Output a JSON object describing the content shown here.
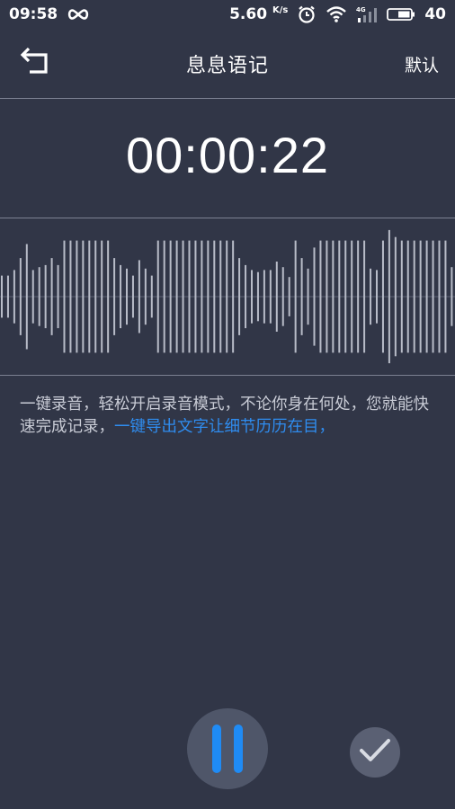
{
  "status_bar": {
    "time": "09:58",
    "speed": "5.60",
    "speed_unit": "K/s",
    "network_label": "4G",
    "battery": "40",
    "icons": [
      "infinity-icon",
      "alarm-icon",
      "wifi-icon",
      "signal-icon",
      "battery-icon"
    ]
  },
  "header": {
    "title": "息息语记",
    "default_label": "默认",
    "back_icon": "back-arrow-icon"
  },
  "timer": "00:00:22",
  "waveform": {
    "color": "#b8bcc8",
    "levels": [
      0.3,
      0.3,
      0.38,
      0.55,
      0.75,
      0.38,
      0.42,
      0.45,
      0.55,
      0.45,
      0.8,
      0.8,
      0.8,
      0.8,
      0.8,
      0.8,
      0.8,
      0.8,
      0.55,
      0.45,
      0.4,
      0.3,
      0.52,
      0.4,
      0.3,
      0.8,
      0.8,
      0.8,
      0.8,
      0.8,
      0.8,
      0.8,
      0.8,
      0.8,
      0.8,
      0.8,
      0.8,
      0.8,
      0.55,
      0.45,
      0.38,
      0.35,
      0.38,
      0.38,
      0.5,
      0.42,
      0.28,
      0.8,
      0.55,
      0.4,
      0.7,
      0.8,
      0.8,
      0.8,
      0.8,
      0.8,
      0.8,
      0.8,
      0.8,
      0.4,
      0.38,
      0.8,
      0.95,
      0.85,
      0.8,
      0.8,
      0.8,
      0.8,
      0.8,
      0.8,
      0.8,
      0.8,
      0.42,
      0.38,
      0.45,
      0.52,
      0.45,
      0.55,
      0.55,
      0.4,
      0.4,
      0.6,
      0.55,
      0.45,
      0.62
    ]
  },
  "description": {
    "text": "一键录音，轻松开启录音模式，不论你身在何处，您就能快速完成记录，",
    "highlight": "一键导出文字让细节历历在目，",
    "highlight_color": "#2f8df0"
  },
  "controls": {
    "pause_icon": "pause-icon",
    "confirm_icon": "checkmark-icon",
    "accent": "#1f8bf5"
  }
}
